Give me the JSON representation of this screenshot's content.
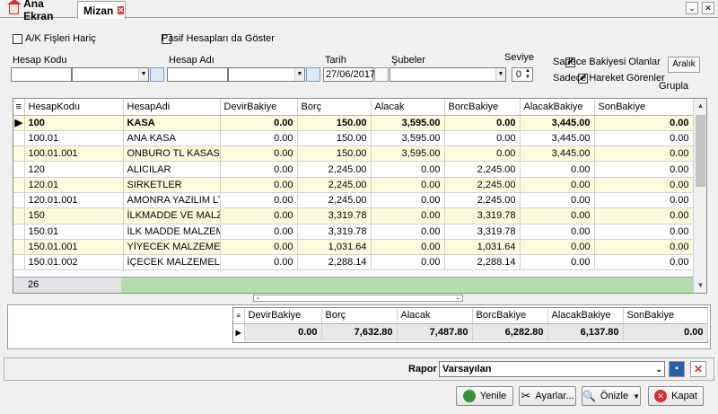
{
  "tabs": [
    {
      "label": "Ana Ekran"
    },
    {
      "label": "Mizan"
    }
  ],
  "filters": {
    "ak_fisleri_haric": {
      "label": "A/K Fişleri Hariç",
      "checked": false
    },
    "pasif_hesaplari": {
      "label": "Pasif Hesapları da Göster",
      "checked": false
    },
    "hesap_kodu_label": "Hesap Kodu",
    "hesap_adi_label": "Hesap Adı",
    "tarih_label": "Tarih",
    "tarih_value": "27/06/2017",
    "subeler_label": "Şubeler",
    "seviye_label": "Seviye",
    "seviye_value": "0",
    "sadece_bakiyesi": {
      "label": "Sadece Bakiyesi Olanlar",
      "checked": true
    },
    "sadece_hareket": {
      "label": "Sadece Hareket Görenler",
      "checked": true
    },
    "aralik_label": "Aralık",
    "grupla": {
      "label": "Grupla",
      "checked": false
    }
  },
  "grid": {
    "columns": [
      "HesapKodu",
      "HesapAdi",
      "DevirBakiye",
      "Borç",
      "Alacak",
      "BorcBakiye",
      "AlacakBakiye",
      "SonBakiye"
    ],
    "rows": [
      [
        "100",
        "KASA",
        "0.00",
        "150.00",
        "3,595.00",
        "0.00",
        "3,445.00",
        "0.00"
      ],
      [
        "100.01",
        "ANA KASA",
        "0.00",
        "150.00",
        "3,595.00",
        "0.00",
        "3,445.00",
        "0.00"
      ],
      [
        "100.01.001",
        "ONBURO TL KASASI",
        "0.00",
        "150.00",
        "3,595.00",
        "0.00",
        "3,445.00",
        "0.00"
      ],
      [
        "120",
        "ALICILAR",
        "0.00",
        "2,245.00",
        "0.00",
        "2,245.00",
        "0.00",
        "0.00"
      ],
      [
        "120.01",
        "SIRKETLER",
        "0.00",
        "2,245.00",
        "0.00",
        "2,245.00",
        "0.00",
        "0.00"
      ],
      [
        "120.01.001",
        "AMONRA YAZILIM LTD",
        "0.00",
        "2,245.00",
        "0.00",
        "2,245.00",
        "0.00",
        "0.00"
      ],
      [
        "150",
        "İLKMADDE VE MALZEM",
        "0.00",
        "3,319.78",
        "0.00",
        "3,319.78",
        "0.00",
        "0.00"
      ],
      [
        "150.01",
        "İLK MADDE MALZEME",
        "0.00",
        "3,319.78",
        "0.00",
        "3,319.78",
        "0.00",
        "0.00"
      ],
      [
        "150.01.001",
        "YİYECEK MALZEMELEF",
        "0.00",
        "1,031.64",
        "0.00",
        "1,031.64",
        "0.00",
        "0.00"
      ],
      [
        "150.01.002",
        "İÇECEK MALZEMELER",
        "0.00",
        "2,288.14",
        "0.00",
        "2,288.14",
        "0.00",
        "0.00"
      ]
    ],
    "row_count": "26"
  },
  "summary": {
    "columns": [
      "DevirBakiye",
      "Borç",
      "Alacak",
      "BorcBakiye",
      "AlacakBakiye",
      "SonBakiye"
    ],
    "values": [
      "0.00",
      "7,632.80",
      "7,487.80",
      "6,282.80",
      "6,137.80",
      "0.00"
    ]
  },
  "rapor": {
    "label": "Rapor",
    "value": "Varsayılan"
  },
  "buttons": {
    "yenile": "Yenile",
    "ayarlar": "Ayarlar...",
    "onizle": "Önizle",
    "kapat": "Kapat"
  },
  "colors": {
    "row_alt": "#fdfbde",
    "footer_green": "#b6dcb0",
    "close_red": "#d33333"
  }
}
